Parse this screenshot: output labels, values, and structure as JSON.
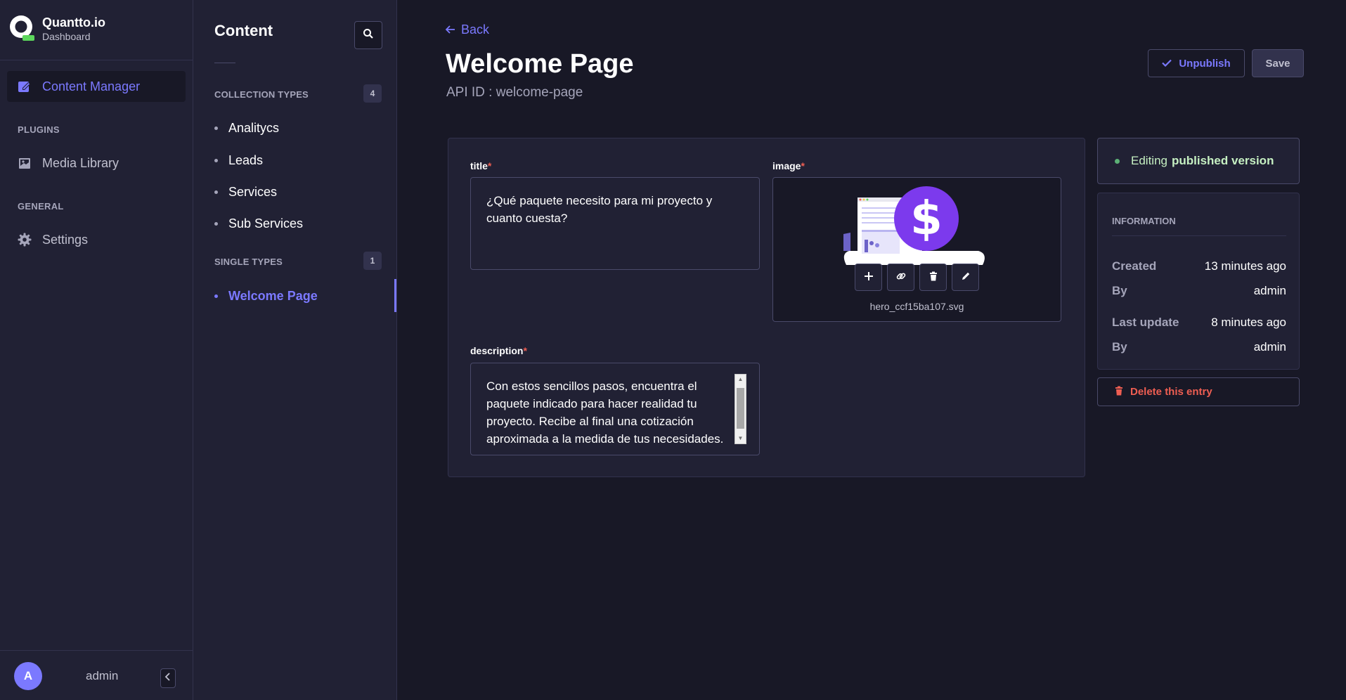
{
  "app": {
    "name": "Quantto.io",
    "subtitle": "Dashboard"
  },
  "leftnav": {
    "content_manager": "Content Manager",
    "plugins_heading": "PLUGINS",
    "media_library": "Media Library",
    "general_heading": "GENERAL",
    "settings": "Settings",
    "user_initial": "A",
    "user_name": "admin"
  },
  "subnav": {
    "title": "Content",
    "collection_heading": "COLLECTION TYPES",
    "collection_count": "4",
    "collection_items": [
      "Analitycs",
      "Leads",
      "Services",
      "Sub Services"
    ],
    "single_heading": "SINGLE TYPES",
    "single_count": "1",
    "single_items": [
      "Welcome Page"
    ]
  },
  "main": {
    "back_label": "Back",
    "page_title": "Welcome Page",
    "api_id": "API ID : welcome-page",
    "unpublish_label": "Unpublish",
    "save_label": "Save",
    "fields": {
      "title_label": "title",
      "title_value": "¿Qué paquete necesito para mi proyecto y cuanto cuesta?",
      "image_label": "image",
      "image_filename": "hero_ccf15ba107.svg",
      "description_label": "description",
      "description_value": "Con estos sencillos pasos, encuentra el paquete indicado para hacer realidad tu proyecto. Recibe al final una cotización aproximada a la medida de tus necesidades.",
      "required_mark": "*"
    }
  },
  "sidepanel": {
    "status_prefix": "Editing",
    "status_strong": "published version",
    "info_title": "INFORMATION",
    "created_label": "Created",
    "created_value": "13 minutes ago",
    "by_label": "By",
    "created_by": "admin",
    "last_update_label": "Last update",
    "last_update_value": "8 minutes ago",
    "updated_by": "admin",
    "delete_label": "Delete this entry"
  },
  "colors": {
    "background": "#181826",
    "panel": "#212134",
    "accent": "#7b79ff",
    "danger": "#ee5e52",
    "success": "#c6f0c2",
    "border": "#4a4a6a"
  },
  "icons": {
    "brand": "quantto-logo-icon",
    "content_manager": "pencil-square-icon",
    "media_library": "image-gallery-icon",
    "settings": "gear-icon",
    "search": "search-icon",
    "back": "arrow-left-icon",
    "unpublish": "check-icon",
    "add": "plus-icon",
    "link": "link-icon",
    "delete": "trash-icon",
    "edit": "pencil-icon",
    "collapse": "chevron-left-icon"
  }
}
